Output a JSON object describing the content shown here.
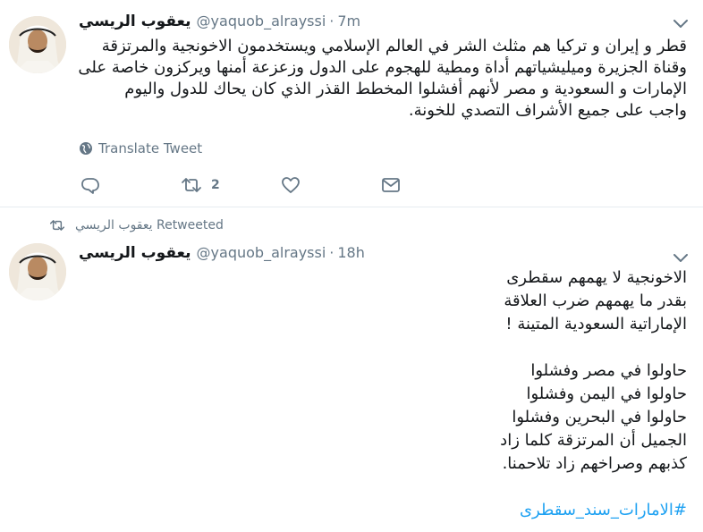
{
  "tweet1": {
    "name": "يعقوب الريسي",
    "handle": "@yaquob_alrayssi",
    "separator": "·",
    "time": "7m",
    "lines": [
      "قطر و إيران و تركيا هم مثلث الشر في العالم الإسلامي ويستخدمون الاخونجية والمرتزقة",
      "وقناة الجزيرة وميليشياتهم أداة ومطية للهجوم على الدول وزعزعة أمنها ويركزون خاصة على",
      "الإمارات و السعودية و مصر لأنهم أفشلوا المخطط القذر الذي كان يحاك للدول واليوم",
      "واجب على جميع الأشراف التصدي للخونة."
    ],
    "translate_label": "Translate Tweet",
    "retweet_count": "2",
    "icons": [
      "reply-icon",
      "retweet-icon",
      "like-icon",
      "message-icon",
      "globe-icon",
      "caret-down-icon"
    ]
  },
  "tweet2": {
    "retweeted_by": "يعقوب الريسي Retweeted",
    "name": "يعقوب الريسي",
    "handle": "@yaquob_alrayssi",
    "separator": "·",
    "time": "18h",
    "lines": [
      "الاخونجية لا يهمهم سقطرى",
      "بقدر ما يهمهم ضرب العلاقة",
      "الإماراتية السعودية المتينة !",
      "",
      "حاولوا في مصر وفشلوا",
      "حاولوا في اليمن وفشلوا",
      "حاولوا في البحرين وفشلوا",
      "الجميل أن المرتزقة كلما زاد",
      "كذبهم وصراخهم زاد تلاحمنا.",
      ""
    ],
    "hashtag": "#الامارات_سند_سقطرى"
  },
  "colors": {
    "text": "#14171a",
    "secondary": "#657786",
    "link": "#1da1f2",
    "divider": "#e6ecf0"
  }
}
